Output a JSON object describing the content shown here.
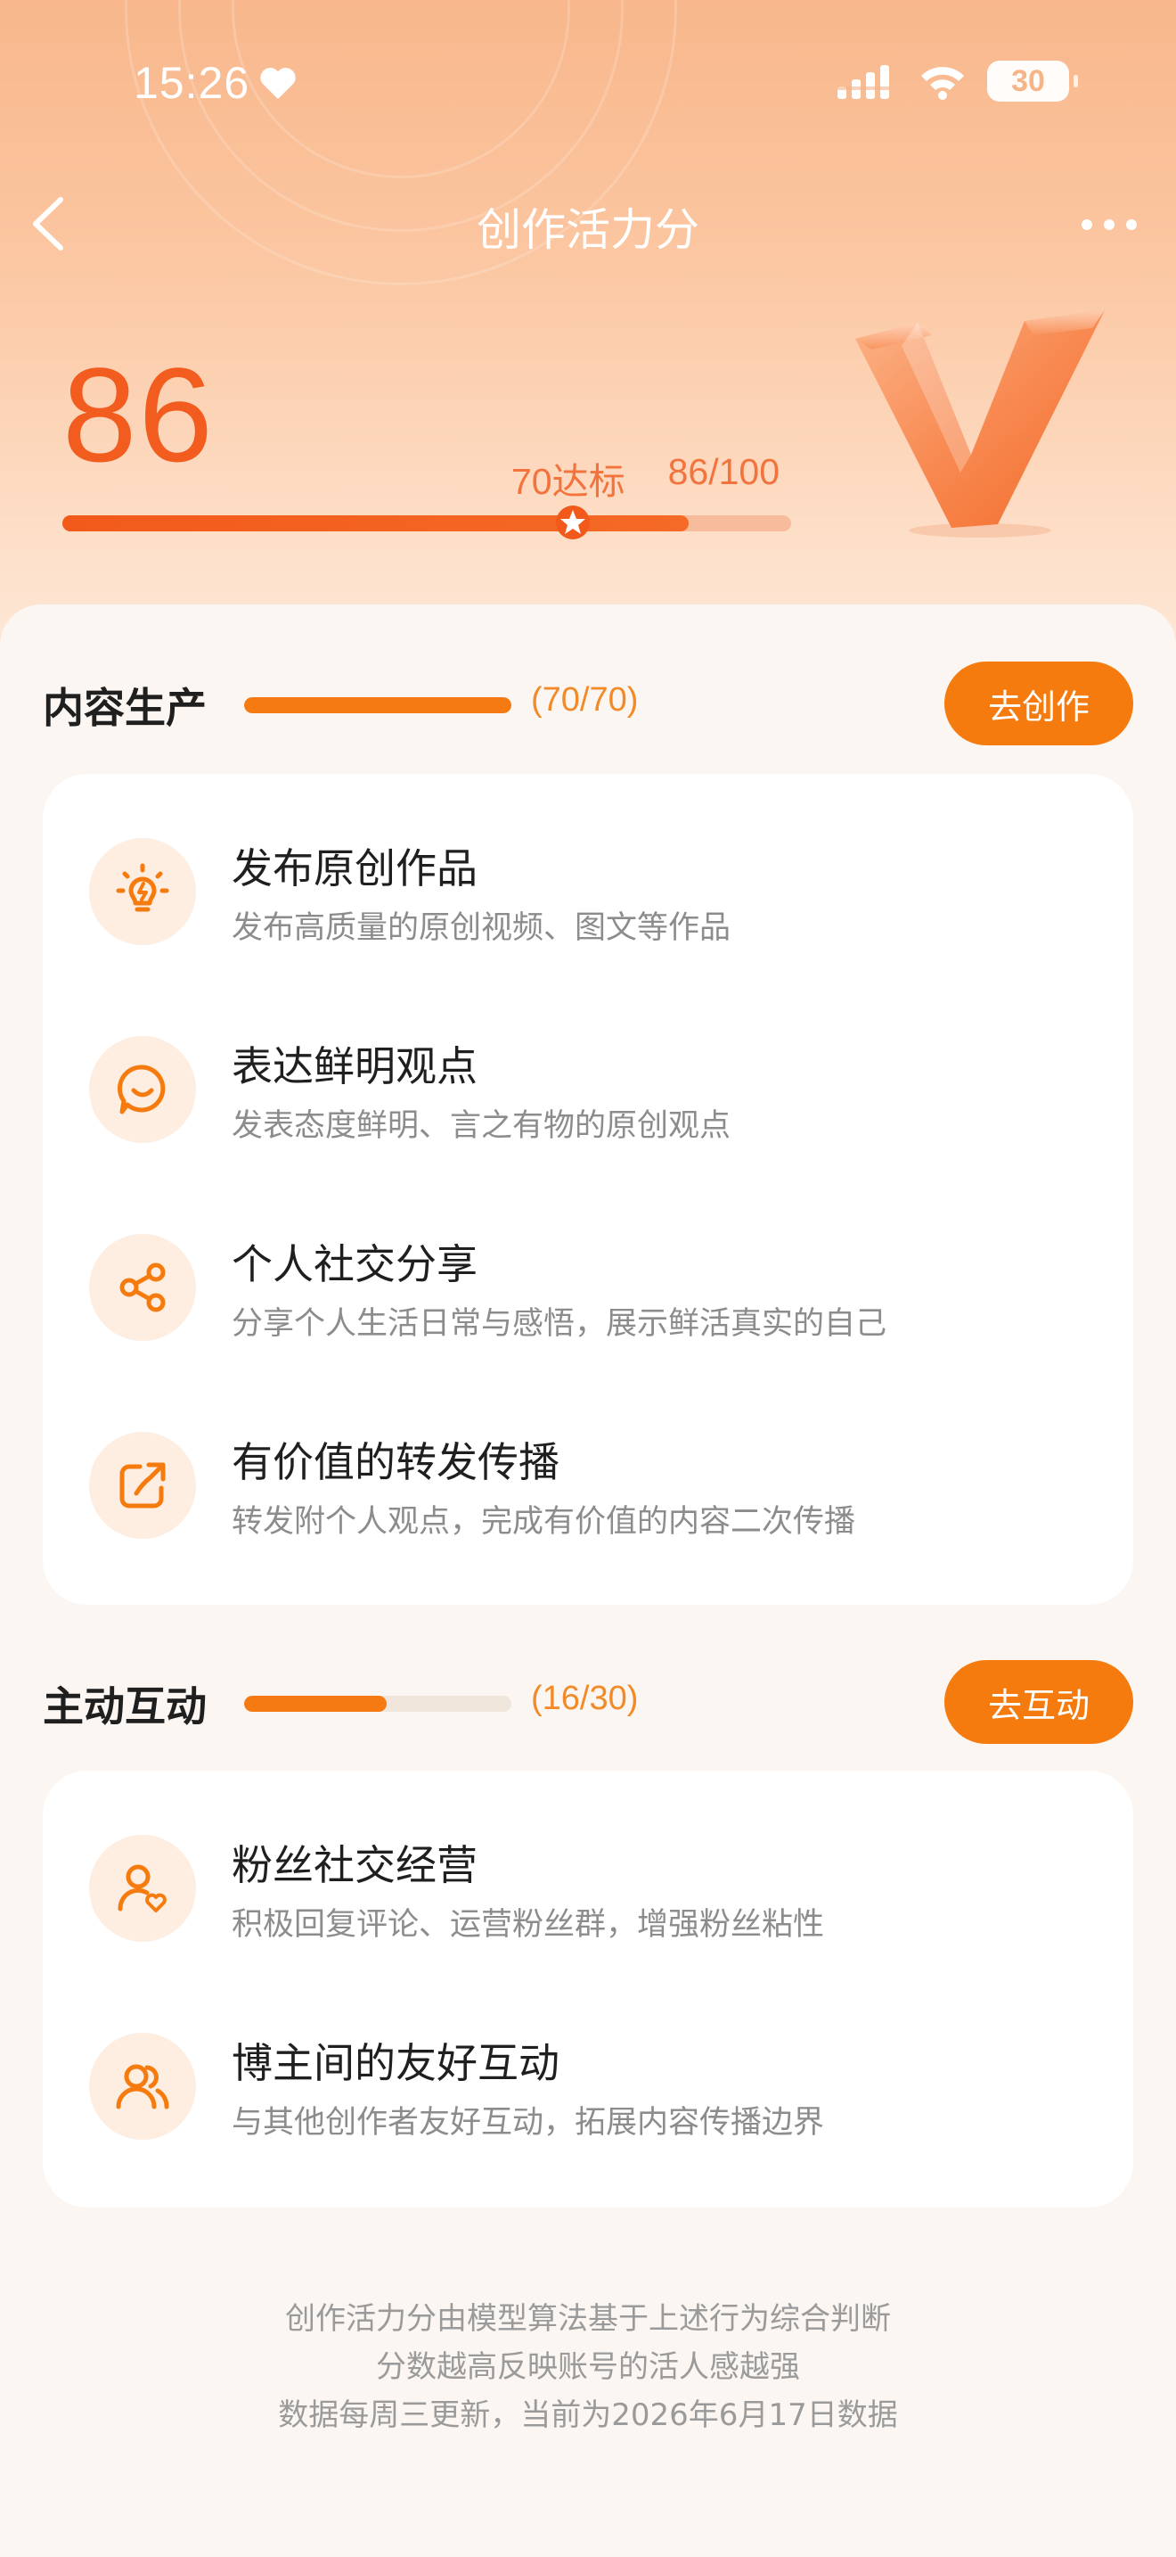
{
  "status_bar": {
    "time": "15:26",
    "battery": "30",
    "icons": [
      "heart-icon",
      "signal-icon",
      "wifi-icon",
      "battery-icon"
    ]
  },
  "nav": {
    "title": "创作活力分",
    "icons": [
      "back-icon",
      "more-icon"
    ]
  },
  "score": {
    "value": "86",
    "target_label": "70达标",
    "progress_label": "86/100",
    "progress_fraction": 0.86,
    "target_fraction": 0.7
  },
  "sections": [
    {
      "title": "内容生产",
      "count": "(70/70)",
      "fraction": 1.0,
      "button": "去创作",
      "items": [
        {
          "icon": "lightbulb-icon",
          "title": "发布原创作品",
          "desc": "发布高质量的原创视频、图文等作品"
        },
        {
          "icon": "smile-chat-icon",
          "title": "表达鲜明观点",
          "desc": "发表态度鲜明、言之有物的原创观点"
        },
        {
          "icon": "share-icon",
          "title": "个人社交分享",
          "desc": "分享个人生活日常与感悟，展示鲜活真实的自己"
        },
        {
          "icon": "forward-icon",
          "title": "有价值的转发传播",
          "desc": "转发附个人观点，完成有价值的内容二次传播"
        }
      ]
    },
    {
      "title": "主动互动",
      "count": "(16/30)",
      "fraction": 0.533,
      "button": "去互动",
      "items": [
        {
          "icon": "fan-heart-icon",
          "title": "粉丝社交经营",
          "desc": "积极回复评论、运营粉丝群，增强粉丝粘性"
        },
        {
          "icon": "users-icon",
          "title": "博主间的友好互动",
          "desc": "与其他创作者友好互动，拓展内容传播边界"
        }
      ]
    }
  ],
  "footer": {
    "line1": "创作活力分由模型算法基于上述行为综合判断",
    "line2": "分数越高反映账号的活人感越强",
    "line3": "数据每周三更新，当前为2026年6月17日数据"
  },
  "colors": {
    "accent": "#f67b0e",
    "score": "#f25c1f",
    "hero_top": "#f8b78c",
    "page_bg": "#fbf6f1"
  }
}
